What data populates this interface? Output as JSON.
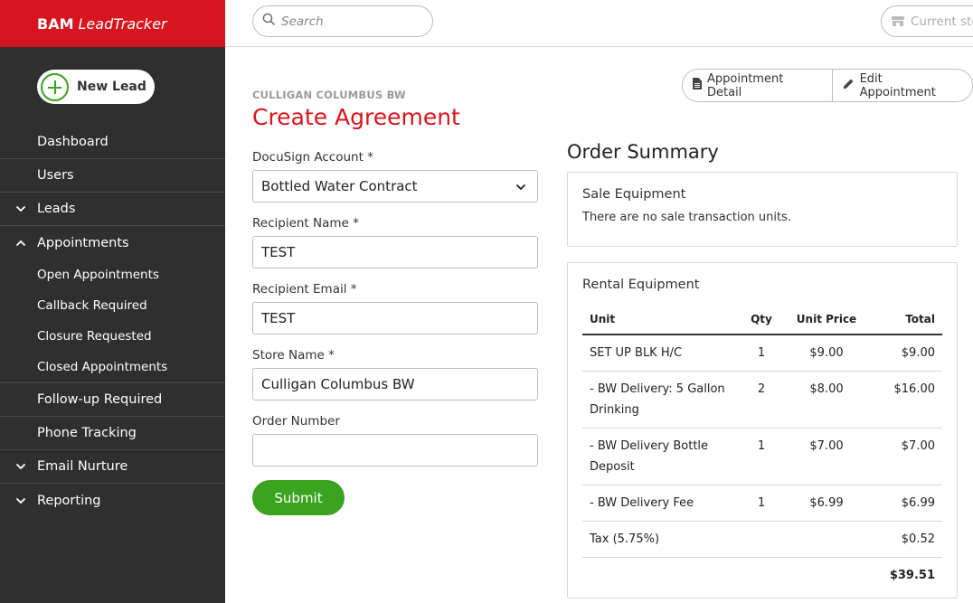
{
  "brand": {
    "bold": "BAM",
    "italic": "LeadTracker"
  },
  "sidebar": {
    "new_lead": "New Lead",
    "items": [
      {
        "label": "Dashboard"
      },
      {
        "label": "Users"
      },
      {
        "label": "Leads"
      },
      {
        "label": "Appointments"
      },
      {
        "label": "Follow-up Required"
      },
      {
        "label": "Phone Tracking"
      },
      {
        "label": "Email Nurture"
      },
      {
        "label": "Reporting"
      }
    ],
    "appointments_sub": [
      {
        "label": "Open Appointments"
      },
      {
        "label": "Callback Required"
      },
      {
        "label": "Closure Requested"
      },
      {
        "label": "Closed Appointments"
      }
    ]
  },
  "topbar": {
    "search_placeholder": "Search",
    "store_label": "Current sto"
  },
  "actions": {
    "appointment_detail": "Appointment Detail",
    "edit_appointment": "Edit Appointment"
  },
  "page": {
    "company": "CULLIGAN COLUMBUS BW",
    "title": "Create Agreement"
  },
  "form": {
    "docusign_label": "DocuSign Account *",
    "docusign_value": "Bottled Water Contract",
    "recipient_name_label": "Recipient Name *",
    "recipient_name_value": "TEST",
    "recipient_email_label": "Recipient Email *",
    "recipient_email_value": "TEST",
    "store_name_label": "Store Name *",
    "store_name_value": "Culligan Columbus BW",
    "order_number_label": "Order Number",
    "order_number_value": "",
    "submit_label": "Submit"
  },
  "order_summary": {
    "title": "Order Summary",
    "sale": {
      "heading": "Sale Equipment",
      "empty": "There are no sale transaction units."
    },
    "rental": {
      "heading": "Rental Equipment",
      "columns": {
        "unit": "Unit",
        "qty": "Qty",
        "price": "Unit Price",
        "total": "Total"
      },
      "rows": [
        {
          "unit": "SET UP BLK H/C",
          "qty": "1",
          "price": "$9.00",
          "total": "$9.00"
        },
        {
          "unit": "- BW Delivery: 5 Gallon Drinking",
          "qty": "2",
          "price": "$8.00",
          "total": "$16.00"
        },
        {
          "unit": "- BW Delivery Bottle Deposit",
          "qty": "1",
          "price": "$7.00",
          "total": "$7.00"
        },
        {
          "unit": "- BW Delivery Fee",
          "qty": "1",
          "price": "$6.99",
          "total": "$6.99"
        }
      ],
      "tax_label": "Tax (5.75%)",
      "tax_value": "$0.52",
      "grand_total": "$39.51"
    }
  },
  "colors": {
    "brand_red": "#d7151e",
    "sidebar_bg": "#2f2f2f",
    "accent_green": "#3aa31f"
  },
  "icons": {
    "search": "search-icon",
    "store": "store-icon",
    "plus": "plus-circle-icon",
    "document": "document-icon",
    "pencil": "pencil-icon",
    "chevron": "chevron-down-icon"
  }
}
